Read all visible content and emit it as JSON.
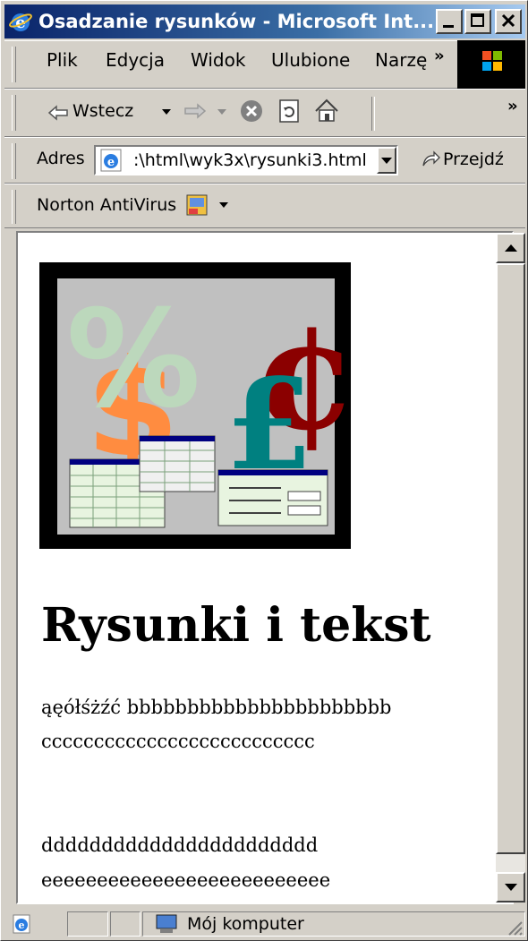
{
  "window": {
    "title": "Osadzanie rysunków - Microsoft Int...",
    "buttons": [
      "minimize",
      "maximize",
      "close"
    ]
  },
  "menu": {
    "items": [
      "Plik",
      "Edycja",
      "Widok",
      "Ulubione",
      "Narzę"
    ],
    "more": "»"
  },
  "toolbar": {
    "back_label": "Wstecz",
    "more": "»"
  },
  "address": {
    "label": "Adres",
    "value": ":\\html\\wyk3x\\rysunki3.html",
    "go_label": "Przejdź"
  },
  "norton": {
    "label": "Norton AntiVirus"
  },
  "page": {
    "heading": "Rysunki i tekst",
    "line1": "ąęółśżźć bbbbbbbbbbbbbbbbbbbbbb",
    "line2": "cccccccccccccccccccccccccc",
    "line3": "ddddddddddddddddddddddd",
    "line4": "eeeeeeeeeeeeeeeeeeeeeeeeee"
  },
  "status": {
    "zone_label": "Mój komputer"
  },
  "colors": {
    "titlebar_start": "#0a246a",
    "titlebar_end": "#a6caf0",
    "chrome": "#d4d0c8"
  }
}
